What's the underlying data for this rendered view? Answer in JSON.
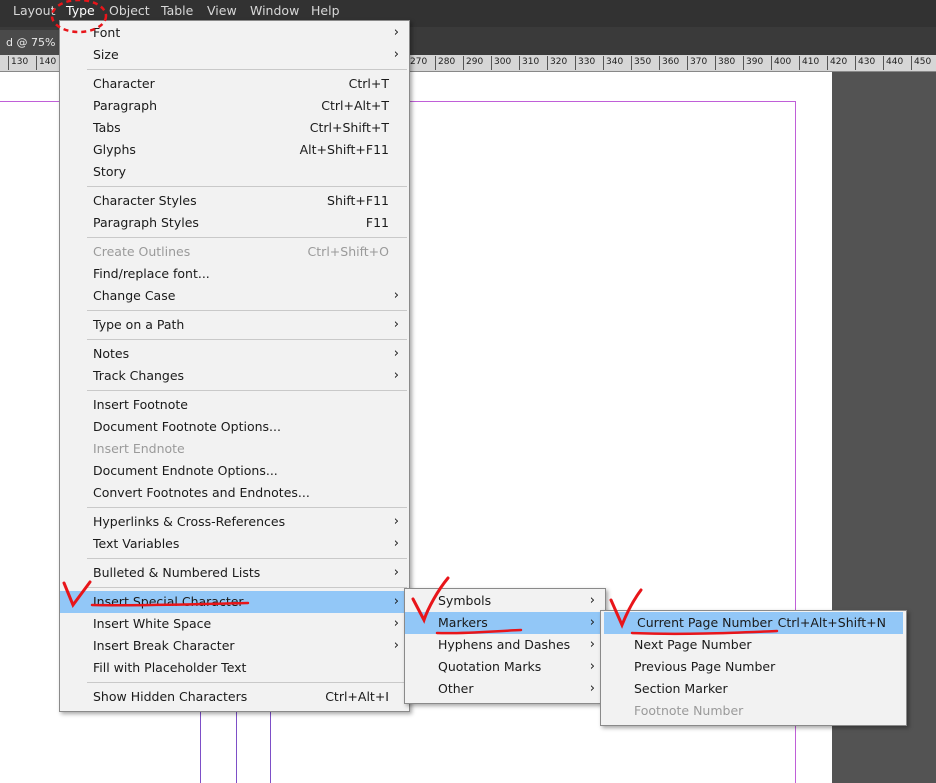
{
  "menubar": {
    "items": [
      "Layout",
      "Type",
      "Object",
      "Table",
      "View",
      "Window",
      "Help"
    ]
  },
  "doc_tab": {
    "label": "d @ 75%"
  },
  "ruler": {
    "ticks": [
      "130",
      "140",
      "270",
      "280",
      "290",
      "300",
      "310",
      "320",
      "330",
      "340",
      "350",
      "360",
      "370",
      "380",
      "390",
      "400",
      "410",
      "420",
      "430",
      "440",
      "450"
    ]
  },
  "type_menu": {
    "items": [
      {
        "label": "Font",
        "shortcut": "",
        "submenu": true,
        "disabled": false
      },
      {
        "label": "Size",
        "shortcut": "",
        "submenu": true,
        "disabled": false
      },
      {
        "label": "Character",
        "shortcut": "Ctrl+T",
        "submenu": false,
        "disabled": false
      },
      {
        "label": "Paragraph",
        "shortcut": "Ctrl+Alt+T",
        "submenu": false,
        "disabled": false
      },
      {
        "label": "Tabs",
        "shortcut": "Ctrl+Shift+T",
        "submenu": false,
        "disabled": false
      },
      {
        "label": "Glyphs",
        "shortcut": "Alt+Shift+F11",
        "submenu": false,
        "disabled": false
      },
      {
        "label": "Story",
        "shortcut": "",
        "submenu": false,
        "disabled": false
      },
      {
        "label": "Character Styles",
        "shortcut": "Shift+F11",
        "submenu": false,
        "disabled": false
      },
      {
        "label": "Paragraph Styles",
        "shortcut": "F11",
        "submenu": false,
        "disabled": false
      },
      {
        "label": "Create Outlines",
        "shortcut": "Ctrl+Shift+O",
        "submenu": false,
        "disabled": true
      },
      {
        "label": "Find/replace font...",
        "shortcut": "",
        "submenu": false,
        "disabled": false
      },
      {
        "label": "Change Case",
        "shortcut": "",
        "submenu": true,
        "disabled": false
      },
      {
        "label": "Type on a Path",
        "shortcut": "",
        "submenu": true,
        "disabled": false
      },
      {
        "label": "Notes",
        "shortcut": "",
        "submenu": true,
        "disabled": false
      },
      {
        "label": "Track Changes",
        "shortcut": "",
        "submenu": true,
        "disabled": false
      },
      {
        "label": "Insert Footnote",
        "shortcut": "",
        "submenu": false,
        "disabled": false
      },
      {
        "label": "Document Footnote Options...",
        "shortcut": "",
        "submenu": false,
        "disabled": false
      },
      {
        "label": "Insert Endnote",
        "shortcut": "",
        "submenu": false,
        "disabled": true
      },
      {
        "label": "Document Endnote Options...",
        "shortcut": "",
        "submenu": false,
        "disabled": false
      },
      {
        "label": "Convert Footnotes and Endnotes...",
        "shortcut": "",
        "submenu": false,
        "disabled": false
      },
      {
        "label": "Hyperlinks & Cross-References",
        "shortcut": "",
        "submenu": true,
        "disabled": false
      },
      {
        "label": "Text Variables",
        "shortcut": "",
        "submenu": true,
        "disabled": false
      },
      {
        "label": "Bulleted & Numbered Lists",
        "shortcut": "",
        "submenu": true,
        "disabled": false
      },
      {
        "label": "Insert Special Character",
        "shortcut": "",
        "submenu": true,
        "disabled": false,
        "highlighted": true
      },
      {
        "label": "Insert White Space",
        "shortcut": "",
        "submenu": true,
        "disabled": false
      },
      {
        "label": "Insert Break Character",
        "shortcut": "",
        "submenu": true,
        "disabled": false
      },
      {
        "label": "Fill with Placeholder Text",
        "shortcut": "",
        "submenu": false,
        "disabled": false
      },
      {
        "label": "Show Hidden Characters",
        "shortcut": "Ctrl+Alt+I",
        "submenu": false,
        "disabled": false
      }
    ]
  },
  "special_char_menu": {
    "items": [
      {
        "label": "Symbols",
        "submenu": true
      },
      {
        "label": "Markers",
        "submenu": true,
        "highlighted": true
      },
      {
        "label": "Hyphens and Dashes",
        "submenu": true
      },
      {
        "label": "Quotation Marks",
        "submenu": true
      },
      {
        "label": "Other",
        "submenu": true
      }
    ]
  },
  "markers_menu": {
    "items": [
      {
        "label": "Current Page Number",
        "shortcut": "Ctrl+Alt+Shift+N",
        "highlighted": true,
        "disabled": false
      },
      {
        "label": "Next Page Number",
        "shortcut": "",
        "disabled": false
      },
      {
        "label": "Previous Page Number",
        "shortcut": "",
        "disabled": false
      },
      {
        "label": "Section Marker",
        "shortcut": "",
        "disabled": false
      },
      {
        "label": "Footnote Number",
        "shortcut": "",
        "disabled": true
      }
    ]
  },
  "colors": {
    "highlight": "#92c7f7",
    "annotation": "#e8151a",
    "margin": "#c05fd8"
  }
}
